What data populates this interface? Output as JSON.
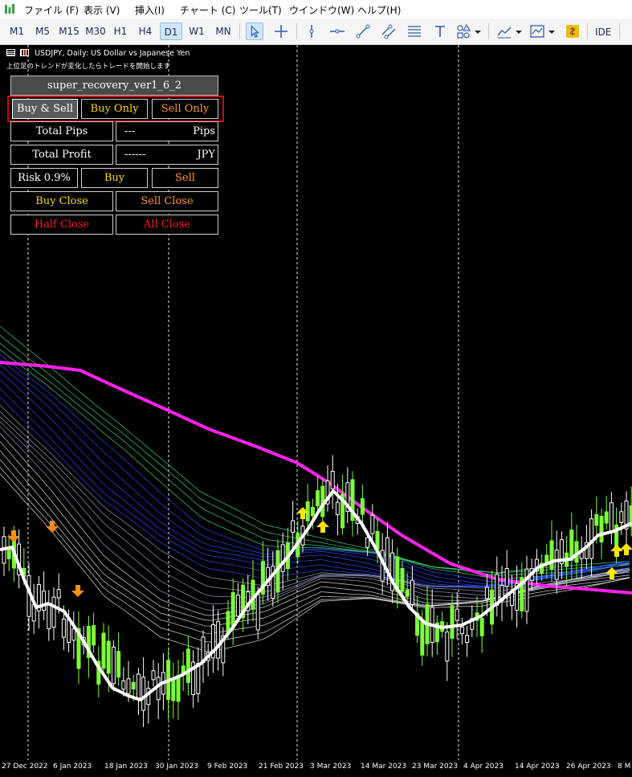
{
  "menu": {
    "items": [
      "ファイル (F)",
      "表示 (V)",
      "挿入(I)",
      "チャート (C)",
      "ツール(T)",
      "ウインドウ(W)",
      "ヘルプ(H)"
    ]
  },
  "toolbar": {
    "timeframes": [
      "M1",
      "M5",
      "M15",
      "M30",
      "H1",
      "H4",
      "D1",
      "W1",
      "MN"
    ],
    "active_timeframe": "D1",
    "ide_label": "IDE"
  },
  "chart": {
    "header": "USDJPY, Daily:  US Dollar vs Japanese Yen",
    "subtext": "上位足のトレンドが変化したらトレードを開始します",
    "dates": [
      "27 Dec 2022",
      "6 Jan 2023",
      "18 Jan 2023",
      "30 Jan 2023",
      "9 Feb 2023",
      "21 Feb 2023",
      "3 Mar 2023",
      "14 Mar 2023",
      "23 Mar 2023",
      "4 Apr 2023",
      "14 Apr 2023",
      "26 Apr 2023",
      "8 M"
    ],
    "colors": {
      "background": "#000000",
      "bull_candle": "#7dff3a",
      "bear_candle": "#ffffff",
      "trend_line": "#ffffff",
      "long_ma": "#ff22ee",
      "ribbon_green": "#3ddc84",
      "ribbon_blue": "#2d4dff",
      "buy_arrow": "#ffe600",
      "sell_arrow": "#ff8c1a"
    }
  },
  "panel": {
    "title": "super_recovery_ver1_6_2",
    "mode_buttons": [
      "Buy & Sell",
      "Buy Only",
      "Sell Only"
    ],
    "selected_mode": "Buy & Sell",
    "total_pips_label": "Total Pips",
    "total_pips_value": "---",
    "total_pips_unit": "Pips",
    "total_profit_label": "Total Profit",
    "total_profit_value": "------",
    "total_profit_unit": "JPY",
    "risk_label": "Risk 0.9%",
    "buy_label": "Buy",
    "sell_label": "Sell",
    "buy_close_label": "Buy Close",
    "sell_close_label": "Sell Close",
    "half_close_label": "Half Close",
    "all_close_label": "All Close",
    "colors": {
      "buy_only": "#ffd700",
      "sell_only": "#ff9a2a",
      "buy": "#ffd700",
      "sell": "#ff9a2a",
      "buy_close": "#ffd700",
      "sell_close": "#ff9a2a",
      "half_close": "#ff1a1a",
      "all_close": "#ff1a1a",
      "highlight_frame": "#e00000"
    }
  }
}
